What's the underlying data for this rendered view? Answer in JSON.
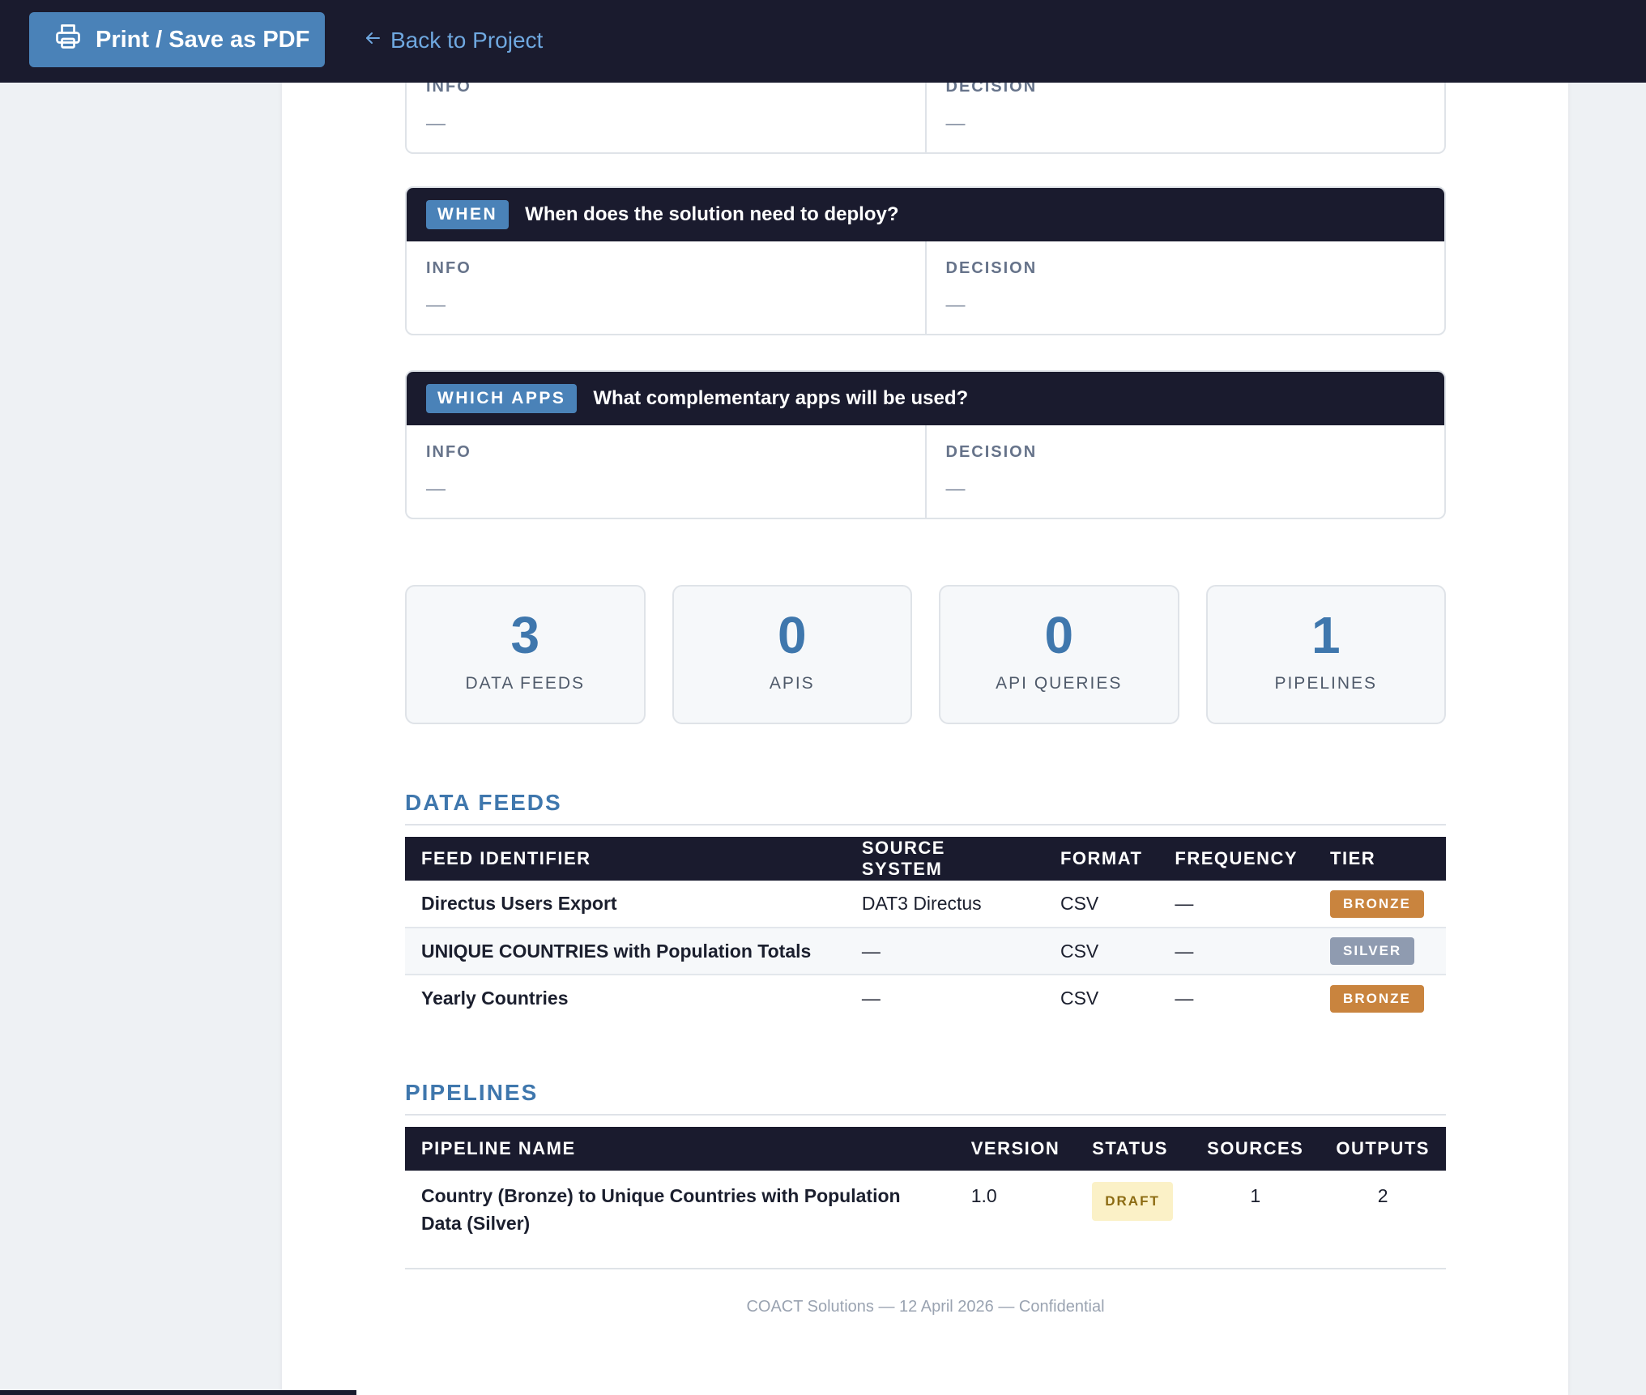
{
  "toolbar": {
    "print_label": "Print / Save as PDF",
    "back_label": "Back to Project"
  },
  "questions": [
    {
      "tag": "",
      "title": "",
      "info_label": "INFO",
      "info_value": "—",
      "decision_label": "DECISION",
      "decision_value": "—"
    },
    {
      "tag": "WHEN",
      "title": "When does the solution need to deploy?",
      "info_label": "INFO",
      "info_value": "—",
      "decision_label": "DECISION",
      "decision_value": "—"
    },
    {
      "tag": "WHICH APPS",
      "title": "What complementary apps will be used?",
      "info_label": "INFO",
      "info_value": "—",
      "decision_label": "DECISION",
      "decision_value": "—"
    }
  ],
  "stats": [
    {
      "value": "3",
      "label": "DATA FEEDS"
    },
    {
      "value": "0",
      "label": "APIS"
    },
    {
      "value": "0",
      "label": "API QUERIES"
    },
    {
      "value": "1",
      "label": "PIPELINES"
    }
  ],
  "data_feeds": {
    "heading": "DATA FEEDS",
    "columns": [
      "FEED IDENTIFIER",
      "SOURCE SYSTEM",
      "FORMAT",
      "FREQUENCY",
      "TIER"
    ],
    "rows": [
      {
        "id": "Directus Users Export",
        "source": "DAT3 Directus",
        "format": "CSV",
        "frequency": "—",
        "tier": "BRONZE"
      },
      {
        "id": "UNIQUE COUNTRIES with Population Totals",
        "source": "—",
        "format": "CSV",
        "frequency": "—",
        "tier": "SILVER"
      },
      {
        "id": "Yearly Countries",
        "source": "—",
        "format": "CSV",
        "frequency": "—",
        "tier": "BRONZE"
      }
    ]
  },
  "pipelines": {
    "heading": "PIPELINES",
    "columns": [
      "PIPELINE NAME",
      "VERSION",
      "STATUS",
      "SOURCES",
      "OUTPUTS"
    ],
    "rows": [
      {
        "name": "Country (Bronze) to Unique Countries with Population Data (Silver)",
        "version": "1.0",
        "status": "DRAFT",
        "sources": "1",
        "outputs": "2"
      }
    ]
  },
  "footer": "COACT Solutions — 12 April 2026 — Confidential",
  "colors": {
    "nav_bg": "#1a1b2e",
    "accent": "#4a82b8",
    "heading_blue": "#3f77ad",
    "bronze": "#c9843e",
    "silver": "#8f9bb0",
    "draft_bg": "#fbf1c7"
  }
}
